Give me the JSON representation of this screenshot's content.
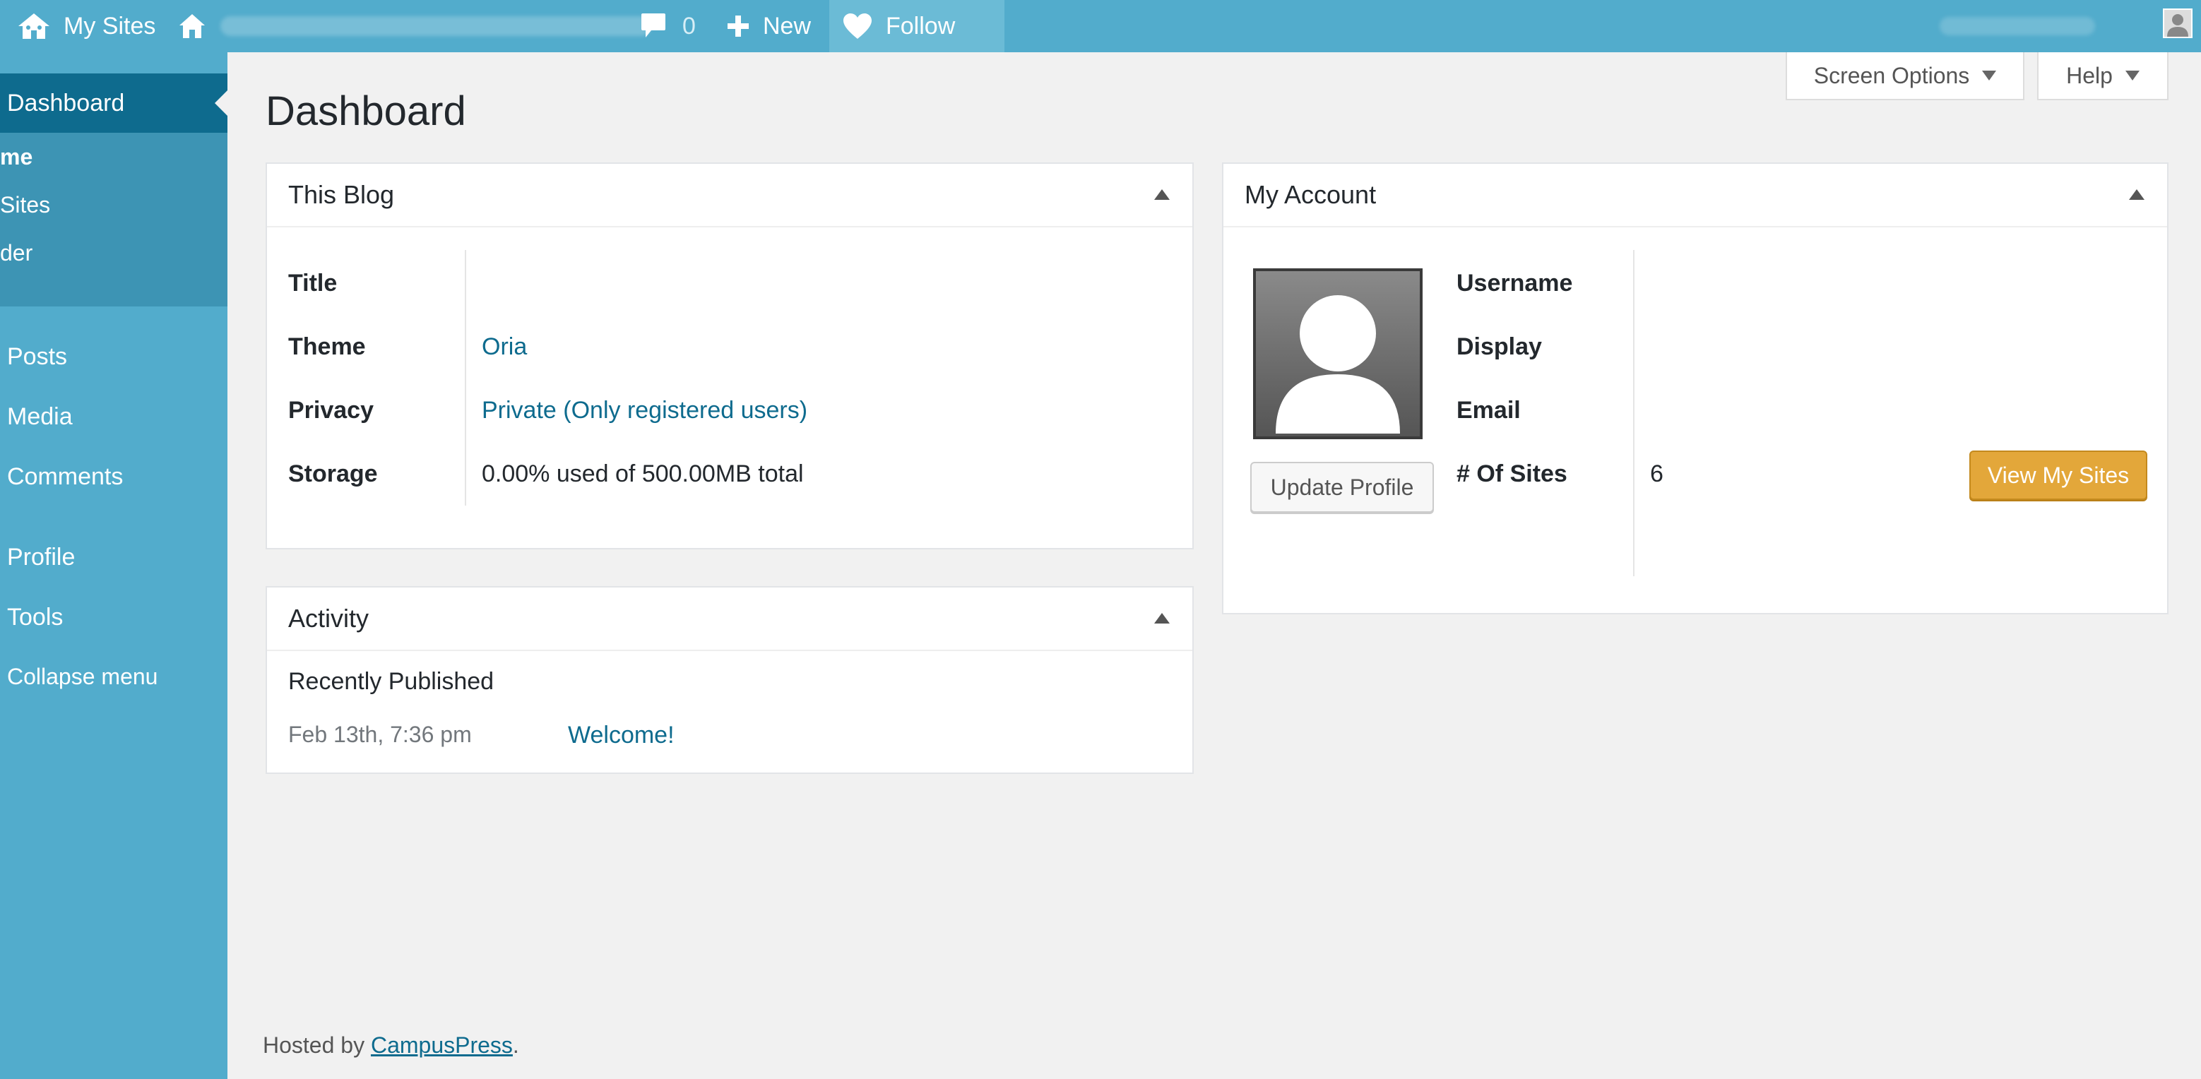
{
  "adminbar": {
    "my_sites": "My Sites",
    "comments_count": "0",
    "new_label": "New",
    "follow_label": "Follow"
  },
  "sidebar": {
    "dashboard": "Dashboard",
    "submenu": [
      "me",
      "Sites",
      "der"
    ],
    "items": [
      "Posts",
      "Media",
      "Comments",
      "Profile",
      "Tools",
      "Collapse menu"
    ]
  },
  "screen_meta": {
    "screen_options": "Screen Options",
    "help": "Help"
  },
  "page": {
    "title": "Dashboard"
  },
  "this_blog": {
    "heading": "This Blog",
    "rows": [
      {
        "label": "Title",
        "value": ""
      },
      {
        "label": "Theme",
        "value": "Oria"
      },
      {
        "label": "Privacy",
        "value": "Private (Only registered users)"
      },
      {
        "label": "Storage",
        "value": "0.00% used of 500.00MB total"
      }
    ]
  },
  "my_account": {
    "heading": "My Account",
    "rows": [
      {
        "label": "Username",
        "value": ""
      },
      {
        "label": "Display",
        "value": ""
      },
      {
        "label": "Email",
        "value": ""
      },
      {
        "label": "# Of Sites",
        "value": "6"
      }
    ],
    "update_profile": "Update Profile",
    "view_my_sites": "View My Sites"
  },
  "activity": {
    "heading": "Activity",
    "subheading": "Recently Published",
    "items": [
      {
        "date": "Feb 13th, 7:36 pm",
        "title": "Welcome!"
      }
    ]
  },
  "footer": {
    "prefix": "Hosted by ",
    "link": "CampusPress",
    "suffix": "."
  },
  "colors": {
    "adminbar": "#52accc",
    "sidebar_active": "#0e6b8e",
    "link": "#0e6b8e",
    "primary_button": "#e3a73a"
  }
}
